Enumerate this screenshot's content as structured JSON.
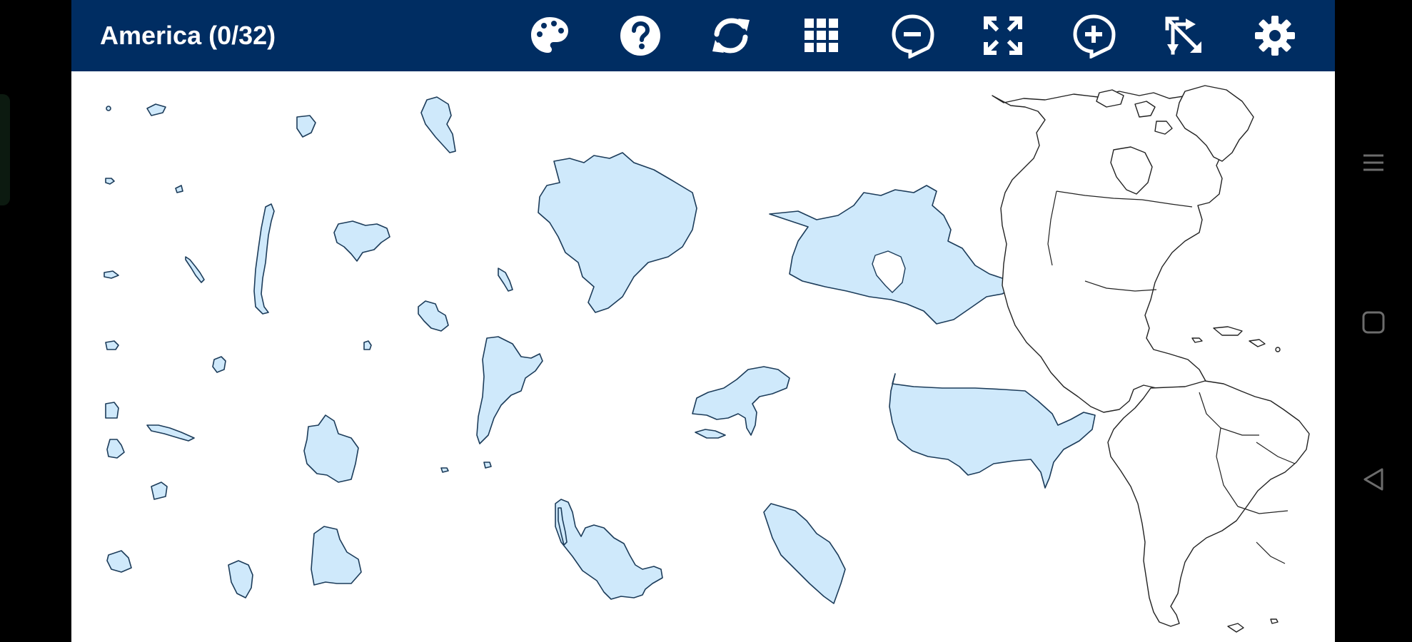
{
  "header": {
    "title": "America (0/32)"
  },
  "toolbar": {
    "tools": [
      {
        "name": "palette-icon"
      },
      {
        "name": "help-icon"
      },
      {
        "name": "refresh-icon"
      },
      {
        "name": "grid-icon"
      },
      {
        "name": "zoom-out-icon"
      },
      {
        "name": "fullscreen-icon"
      },
      {
        "name": "zoom-in-icon"
      },
      {
        "name": "shuffle-icon"
      },
      {
        "name": "settings-icon"
      }
    ]
  },
  "puzzle": {
    "placed": 0,
    "total": 32
  },
  "colors": {
    "toolbar_bg": "#002d62",
    "piece_fill": "#cfe9fb",
    "piece_stroke": "#1c3c5a",
    "map_stroke": "#222222"
  },
  "navigation_bar": {
    "buttons": [
      "menu-icon",
      "home-icon",
      "back-icon"
    ]
  }
}
